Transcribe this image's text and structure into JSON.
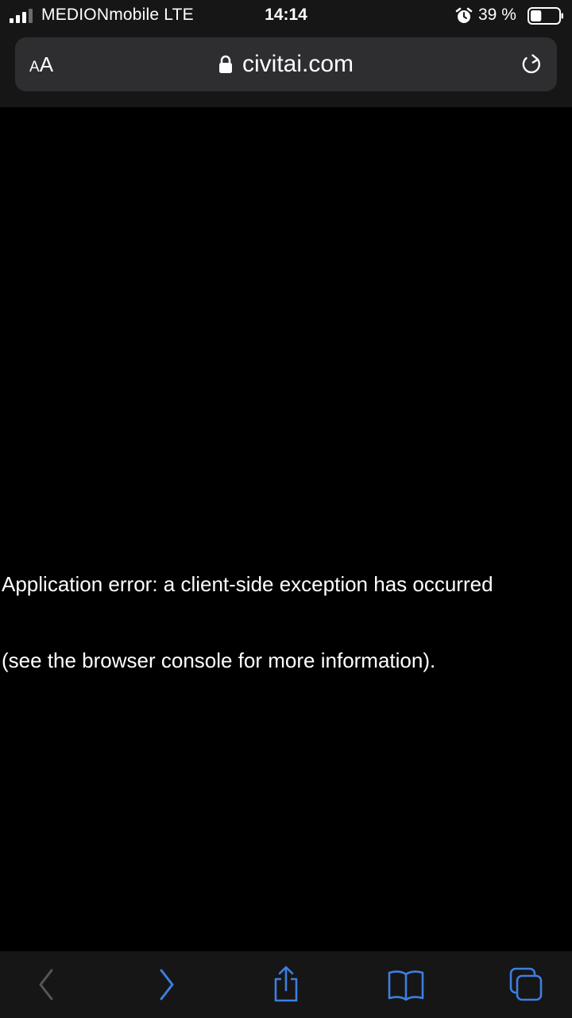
{
  "status_bar": {
    "carrier": "MEDIONmobile  LTE",
    "time": "14:14",
    "battery_percent": "39 %",
    "battery_level": 0.39,
    "icons": [
      "signal-icon",
      "alarm-icon",
      "battery-icon"
    ]
  },
  "address_bar": {
    "reader_small": "A",
    "reader_big": "A",
    "url": "civitai.com",
    "icons": [
      "lock-icon",
      "reload-icon"
    ]
  },
  "content": {
    "error_line_1": "Application error: a client-side exception has occurred",
    "error_line_2": "(see the browser console for more information)."
  },
  "toolbar": {
    "icons": [
      "back-icon",
      "forward-icon",
      "share-icon",
      "bookmarks-icon",
      "tabs-icon"
    ]
  },
  "colors": {
    "chrome_background": "#161616",
    "address_bar_background": "#2e2e30",
    "page_background": "#000000",
    "text": "#ffffff",
    "accent": "#3d7fe0",
    "disabled": "#555558"
  }
}
